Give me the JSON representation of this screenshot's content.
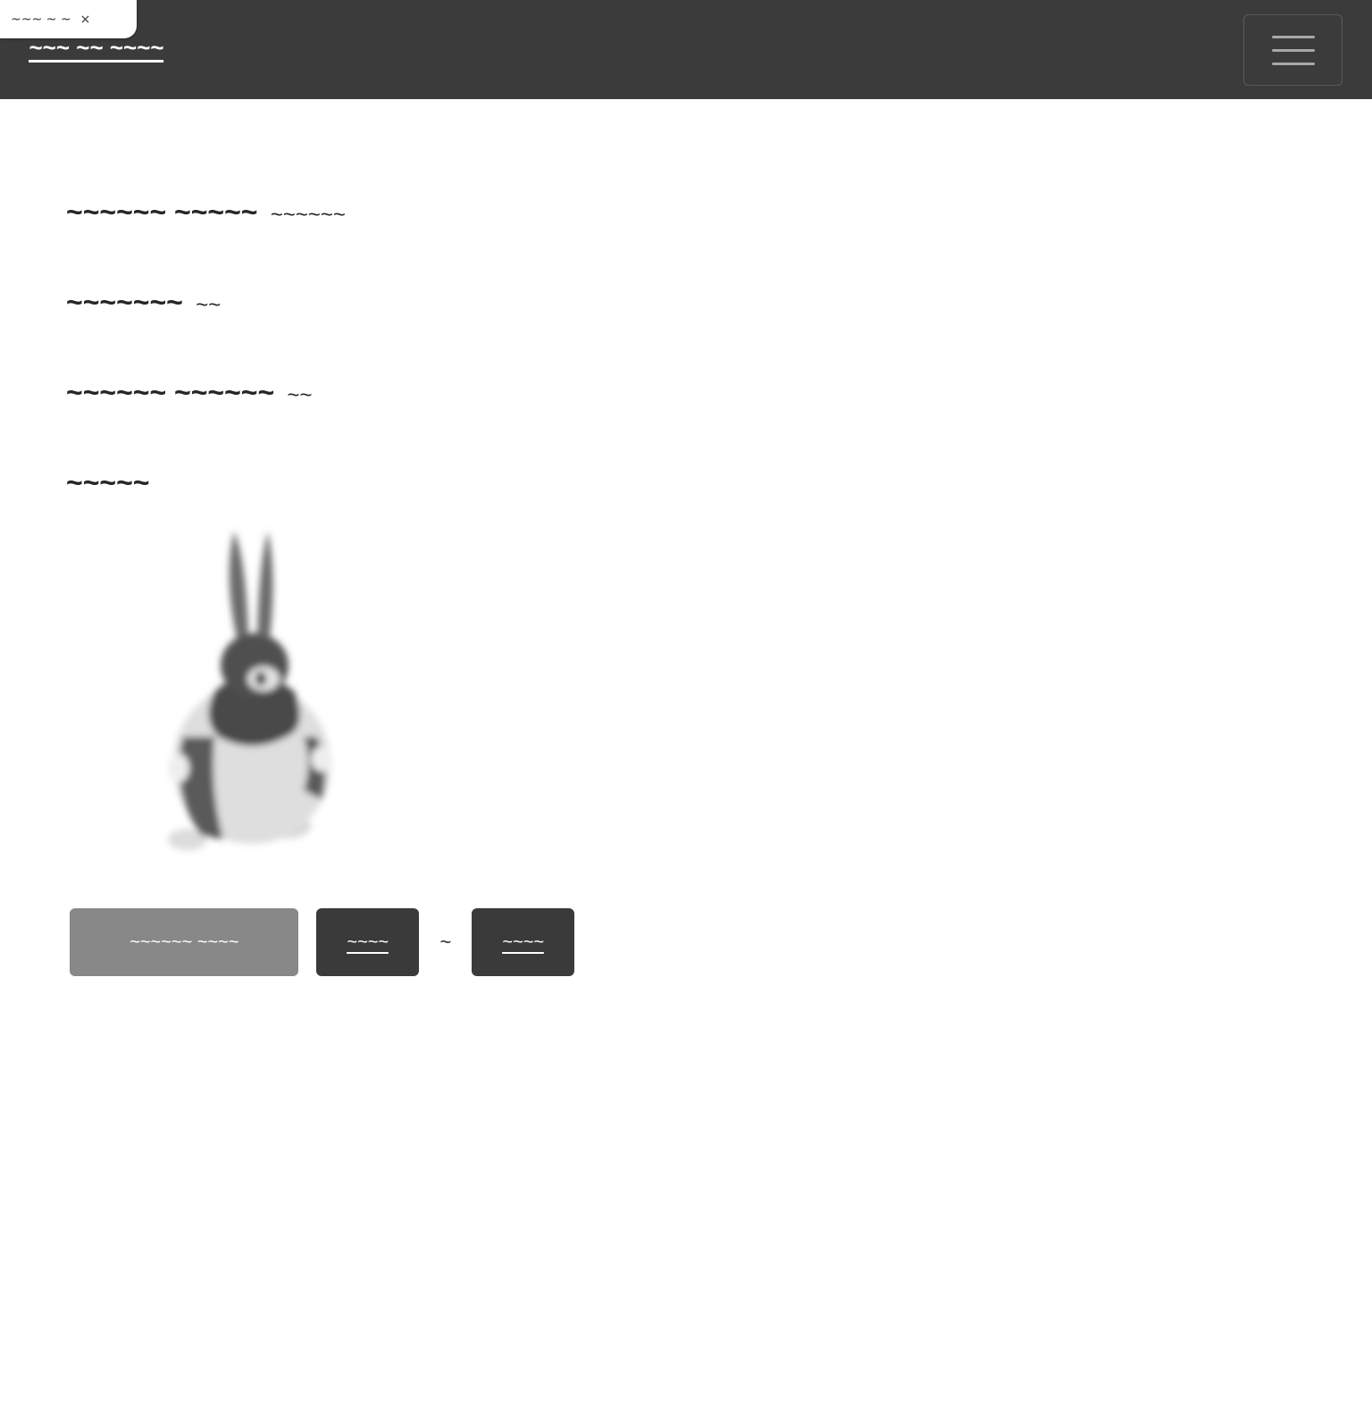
{
  "browser_tab": {
    "title": "~~~ ~ ~",
    "close_glyph": "×"
  },
  "navbar": {
    "brand": "~~~ ~~ ~~~~",
    "menu_icon": "hamburger-menu-icon"
  },
  "main": {
    "lines": [
      {
        "label": "~~~~~~ ~~~~~",
        "value": "~~~~~~"
      },
      {
        "label": "~~~~~~~",
        "value": "~~"
      },
      {
        "label": "~~~~~~ ~~~~~~",
        "value": "~~"
      },
      {
        "label": "~~~~~",
        "value": ""
      }
    ],
    "image_icon": "bunny-illustration"
  },
  "actions": {
    "secondary_label": "~~~~~~ ~~~~",
    "primary_label": "~~~~",
    "separator": "~",
    "secondary_dark_label": "~~~~"
  },
  "colors": {
    "navbar_bg": "#3b3b3b",
    "button_secondary": "#888888",
    "button_dark": "#3a3a3a",
    "text": "#262626"
  }
}
